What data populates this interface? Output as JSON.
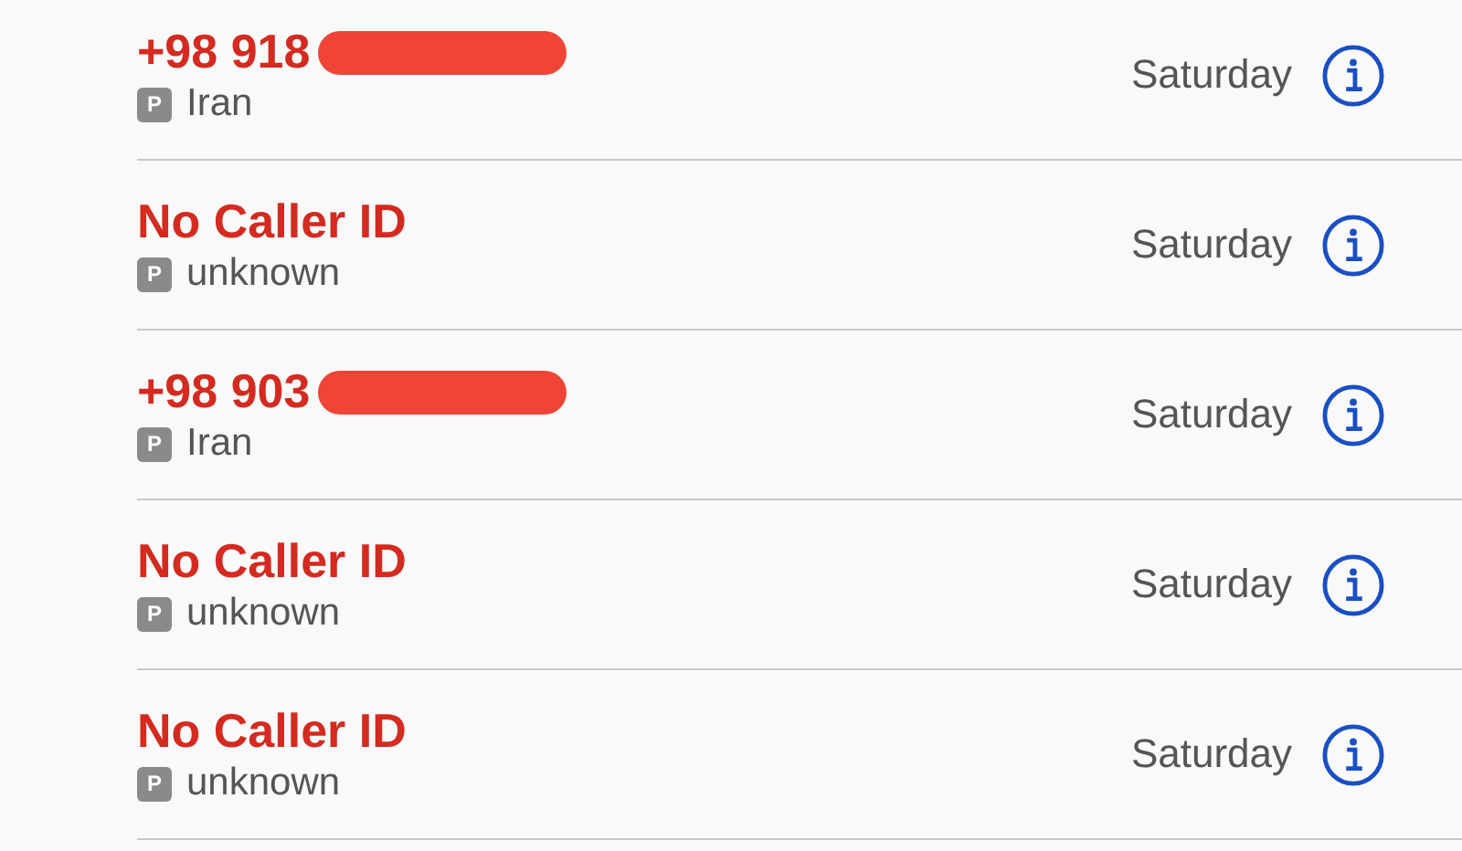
{
  "calls": [
    {
      "title": "+98 918",
      "redacted": true,
      "badge": "P",
      "label": "Iran",
      "day": "Saturday"
    },
    {
      "title": "No Caller ID",
      "redacted": false,
      "badge": "P",
      "label": "unknown",
      "day": "Saturday"
    },
    {
      "title": "+98 903",
      "redacted": true,
      "badge": "P",
      "label": "Iran",
      "day": "Saturday"
    },
    {
      "title": "No Caller ID",
      "redacted": false,
      "badge": "P",
      "label": "unknown",
      "day": "Saturday"
    },
    {
      "title": "No Caller ID",
      "redacted": false,
      "badge": "P",
      "label": "unknown",
      "day": "Saturday"
    }
  ]
}
